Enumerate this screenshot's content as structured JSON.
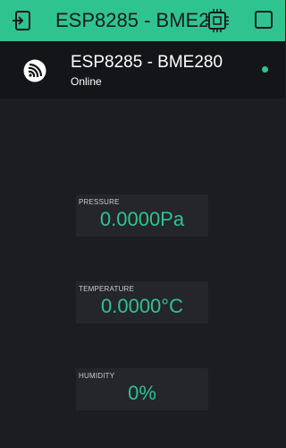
{
  "topbar": {
    "title": "ESP8285 - BME280",
    "back_icon": "back-arrow-icon",
    "device_icon": "chip-icon",
    "menu_icon": "square-icon"
  },
  "device": {
    "name": "ESP8285 - BME280",
    "status": "Online",
    "logo_icon": "espressif-logo",
    "status_color": "#2fc48f"
  },
  "widgets": [
    {
      "label": "PRESSURE",
      "value": "0.0000Pa"
    },
    {
      "label": "TEMPERATURE",
      "value": "0.0000°C"
    },
    {
      "label": "HUMIDITY",
      "value": "0%"
    }
  ],
  "colors": {
    "accent": "#2fc48f",
    "background": "#1b1d21",
    "header": "#141518",
    "widget": "#24262b"
  }
}
